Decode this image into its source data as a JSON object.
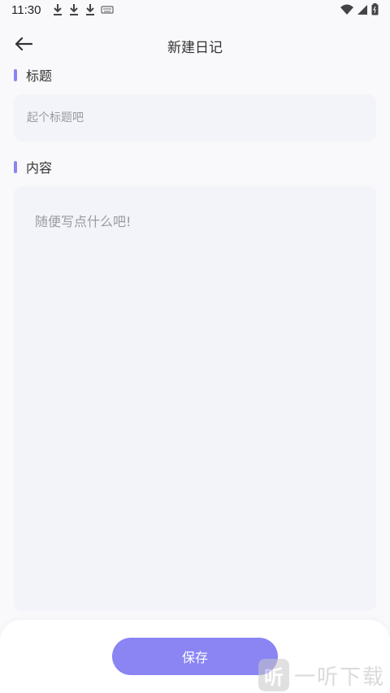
{
  "status_bar": {
    "time": "11:30",
    "left_icons": [
      "download-icon",
      "download-icon",
      "download-icon",
      "keyboard-icon"
    ],
    "right_icons": [
      "wifi-icon",
      "signal-icon",
      "battery-icon"
    ]
  },
  "header": {
    "back_icon": "arrow-left-icon",
    "title": "新建日记"
  },
  "form": {
    "title_label": "标题",
    "title_placeholder": "起个标题吧",
    "title_value": "",
    "content_label": "内容",
    "content_placeholder": "随便写点什么吧!",
    "content_value": ""
  },
  "footer": {
    "save_label": "保存"
  },
  "watermark": {
    "logo_glyph": "听",
    "text": "一听下载"
  },
  "colors": {
    "accent": "#8a85f3",
    "field_bg": "#f3f4f9",
    "page_bg": "#f9f9fb"
  }
}
